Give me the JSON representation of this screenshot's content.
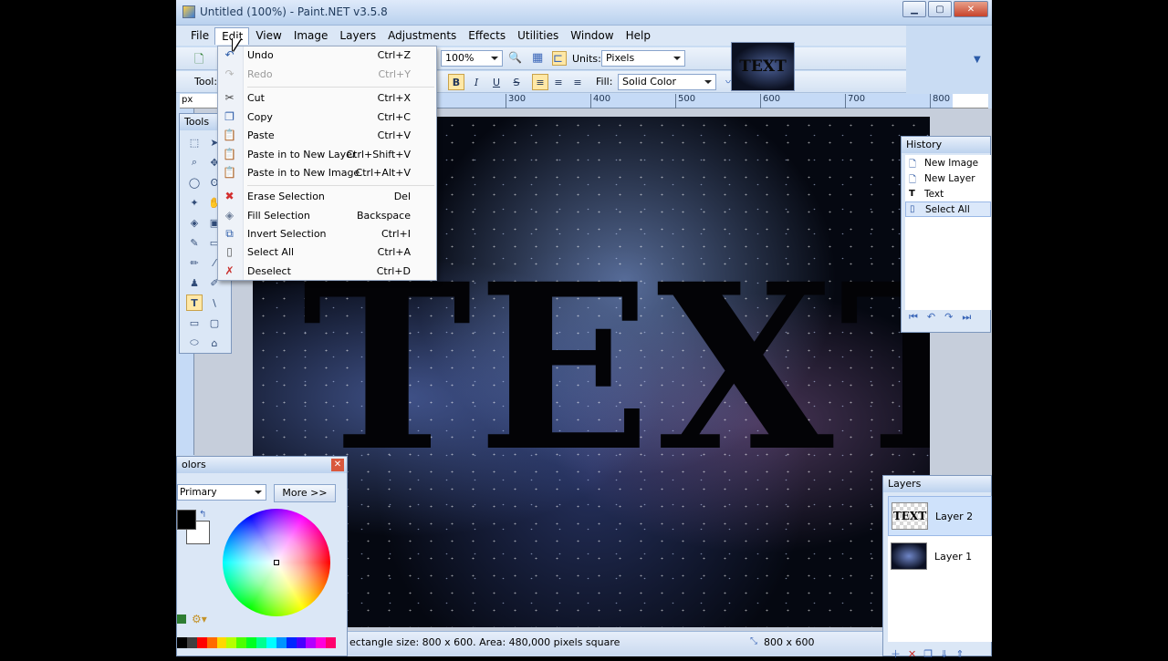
{
  "window": {
    "title": "Untitled (100%) - Paint.NET v3.5.8",
    "buttons": [
      "minimize",
      "maximize",
      "close"
    ]
  },
  "menubar": {
    "items": [
      "File",
      "Edit",
      "View",
      "Image",
      "Layers",
      "Adjustments",
      "Effects",
      "Utilities",
      "Window",
      "Help"
    ],
    "active": "Edit"
  },
  "toolbar": {
    "tool_label": "Tool:",
    "zoom": "100%",
    "units_label": "Units:",
    "units": "Pixels",
    "fill_label": "Fill:",
    "fill": "Solid Color"
  },
  "ruler": {
    "unit": "px",
    "ticks": [
      "300",
      "400",
      "500",
      "600",
      "700",
      "800"
    ]
  },
  "canvas": {
    "text": "TEXT"
  },
  "thumbnail": {
    "text": "TEXT"
  },
  "tools_panel": {
    "title": "Tools"
  },
  "history_panel": {
    "title": "History",
    "items": [
      {
        "label": "New Image",
        "icon": "new-image-icon"
      },
      {
        "label": "New Layer",
        "icon": "new-layer-icon"
      },
      {
        "label": "Text",
        "icon": "text-tool-icon"
      },
      {
        "label": "Select All",
        "icon": "select-all-icon",
        "selected": true
      }
    ]
  },
  "colors_panel": {
    "title": "olors",
    "mode": "Primary",
    "more_button": "More >>",
    "primary_color": "#000000",
    "secondary_color": "#ffffff"
  },
  "layers_panel": {
    "title": "Layers",
    "items": [
      {
        "name": "Layer 2",
        "thumb_text": "TEXT",
        "selected": true
      },
      {
        "name": "Layer 1",
        "selected": false
      }
    ]
  },
  "status_bar": {
    "message": "ectangle size: 800 x 600. Area: 480,000 pixels square",
    "image_size": "800 x 600"
  },
  "edit_menu": {
    "items": [
      {
        "label": "Undo",
        "shortcut": "Ctrl+Z",
        "icon": "undo-icon",
        "enabled": true
      },
      {
        "label": "Redo",
        "shortcut": "Ctrl+Y",
        "icon": "redo-icon",
        "enabled": false
      },
      {
        "label": "Cut",
        "shortcut": "Ctrl+X",
        "icon": "cut-icon",
        "enabled": true
      },
      {
        "label": "Copy",
        "shortcut": "Ctrl+C",
        "icon": "copy-icon",
        "enabled": true
      },
      {
        "label": "Paste",
        "shortcut": "Ctrl+V",
        "icon": "paste-icon",
        "enabled": true
      },
      {
        "label": "Paste in to New Layer",
        "shortcut": "Ctrl+Shift+V",
        "icon": "paste-new-layer-icon",
        "enabled": true
      },
      {
        "label": "Paste in to New Image",
        "shortcut": "Ctrl+Alt+V",
        "icon": "paste-new-image-icon",
        "enabled": true
      },
      {
        "label": "Erase Selection",
        "shortcut": "Del",
        "icon": "erase-selection-icon",
        "enabled": true
      },
      {
        "label": "Fill Selection",
        "shortcut": "Backspace",
        "icon": "fill-selection-icon",
        "enabled": true
      },
      {
        "label": "Invert Selection",
        "shortcut": "Ctrl+I",
        "icon": "invert-selection-icon",
        "enabled": true
      },
      {
        "label": "Select All",
        "shortcut": "Ctrl+A",
        "icon": "select-all-icon",
        "enabled": true
      },
      {
        "label": "Deselect",
        "shortcut": "Ctrl+D",
        "icon": "deselect-icon",
        "enabled": true
      }
    ]
  }
}
